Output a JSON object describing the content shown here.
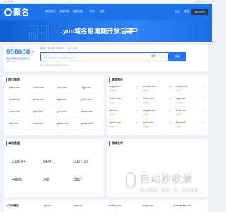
{
  "topbar": {
    "left": "客户服务 | 聚名",
    "right": "登录 注册 | 会员中心"
  },
  "nav": {
    "logo": "聚名",
    "items": [
      "域名首页",
      "域名交易",
      "域名注册",
      "一口价",
      "拍卖"
    ],
    "right_items": [
      "企业",
      "建站"
    ],
    "button": "聚名APP"
  },
  "banner": {
    "title": ".yun域名抢滩期开放活动",
    "button": "立即查看"
  },
  "search": {
    "big_number": "900000",
    "big_number_suffix": "+用户",
    "desc": "聚名网域名注册交易平台",
    "desc2": "juming.com",
    "tabs": [
      "精品查",
      "域名注册",
      "域名过户",
      "一口价",
      "综合"
    ],
    "placeholder": "输入关键字搜索,以空格分隔多个关键词",
    "select": "全选",
    "button": "搜索",
    "hot": "热门: .com .cn .net .top .xyz .vip .cc"
  },
  "panel_hot": {
    "title": "热门推荐",
    "rows": [
      [
        "jubiq.com",
        "xcxw.com",
        "xpqt.com",
        "ztgjt.com"
      ],
      [
        "aimft.com",
        "pxrm.com",
        "tqjx.com",
        "zjpyi.com"
      ],
      [
        "zxah.com",
        "rgkf.com",
        "yjpa.com",
        "wdnw.com"
      ],
      [
        "kryr.com",
        "ncqr.com",
        "gdhm.com",
        "ypqm.com"
      ]
    ]
  },
  "panel_rec": {
    "title": "域名特价",
    "items": [
      {
        "name": "mqju.com",
        "sub": "5天 预计",
        "price": "￥3880"
      },
      {
        "name": "huocha.com",
        "sub": "",
        "price": "￥200"
      },
      {
        "name": "cnhtz.com",
        "sub": "",
        "price": "￥10"
      },
      {
        "name": "rtxhm.com",
        "sub": "",
        "price": "￥200"
      },
      {
        "name": "bhztx.com",
        "sub": "",
        "price": "￥450"
      },
      {
        "name": "lzjpy.com",
        "sub": "",
        "price": "￥1390"
      },
      {
        "name": "ixtt.com",
        "sub": "",
        "price": "￥720"
      },
      {
        "name": "szogdt.com",
        "sub": "",
        "price": "￥200"
      },
      {
        "name": "fbxw.com",
        "sub": "",
        "price": "￥60"
      },
      {
        "name": "npwh.com",
        "sub": "",
        "price": "￥80"
      },
      {
        "name": "xpmh.com",
        "sub": "",
        "price": "￥150"
      },
      {
        "name": "kbtq.com",
        "sub": "",
        "price": "￥46"
      }
    ]
  },
  "panel_stats": {
    "title": "本站数据",
    "items": [
      {
        "num": "2126044",
        "label": ""
      },
      {
        "num": "64747",
        "label": ""
      },
      {
        "num": "2127101",
        "label": ""
      },
      {
        "num": "46626",
        "label": ""
      },
      {
        "num": "342",
        "label": ""
      },
      {
        "num": "2217",
        "label": ""
      }
    ]
  },
  "panel_news": {
    "title": "购域文学",
    "text": ""
  },
  "watermark": {
    "t1": "自动秒收录",
    "t2": "做上链接 · 来访一次 · 自动收录"
  },
  "bottom": {
    "title": "一口价精选",
    "items": [
      "tpc.cn",
      "dzvp.cn",
      "doidwa.com",
      "pkogo.com",
      "godenights.com"
    ]
  }
}
